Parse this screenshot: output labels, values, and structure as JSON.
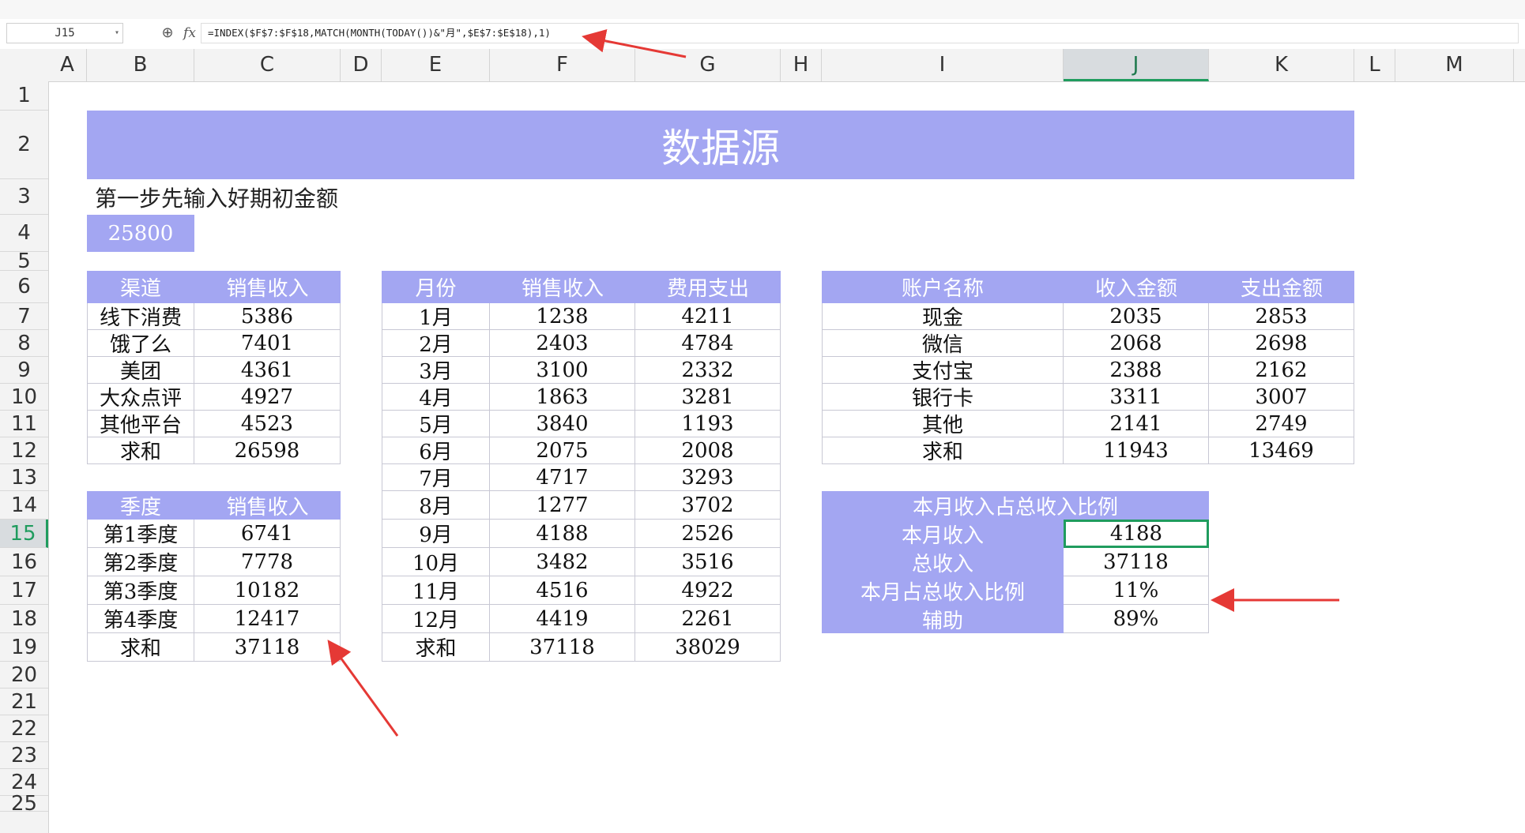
{
  "formula_bar": {
    "name_box": "J15",
    "formula": "=INDEX($F$7:$F$18,MATCH(MONTH(TODAY())&\"月\",$E$7:$E$18),1)"
  },
  "columns": [
    "A",
    "B",
    "C",
    "D",
    "E",
    "F",
    "G",
    "H",
    "I",
    "J",
    "K",
    "L",
    "M"
  ],
  "selected_column": "J",
  "rows": [
    "1",
    "2",
    "3",
    "4",
    "5",
    "6",
    "7",
    "8",
    "9",
    "10",
    "11",
    "12",
    "13",
    "14",
    "15",
    "16",
    "17",
    "18",
    "19",
    "20",
    "21",
    "22",
    "23",
    "24",
    "25"
  ],
  "selected_row": "15",
  "banner": "数据源",
  "step_text": "第一步先输入好期初金额",
  "initial_amount": "25800",
  "channel_table": {
    "headers": [
      "渠道",
      "销售收入"
    ],
    "rows": [
      [
        "线下消费",
        "5386"
      ],
      [
        "饿了么",
        "7401"
      ],
      [
        "美团",
        "4361"
      ],
      [
        "大众点评",
        "4927"
      ],
      [
        "其他平台",
        "4523"
      ],
      [
        "求和",
        "26598"
      ]
    ]
  },
  "quarter_table": {
    "headers": [
      "季度",
      "销售收入"
    ],
    "rows": [
      [
        "第1季度",
        "6741"
      ],
      [
        "第2季度",
        "7778"
      ],
      [
        "第3季度",
        "10182"
      ],
      [
        "第4季度",
        "12417"
      ],
      [
        "求和",
        "37118"
      ]
    ]
  },
  "month_table": {
    "headers": [
      "月份",
      "销售收入",
      "费用支出"
    ],
    "rows": [
      [
        "1月",
        "1238",
        "4211"
      ],
      [
        "2月",
        "2403",
        "4784"
      ],
      [
        "3月",
        "3100",
        "2332"
      ],
      [
        "4月",
        "1863",
        "3281"
      ],
      [
        "5月",
        "3840",
        "1193"
      ],
      [
        "6月",
        "2075",
        "2008"
      ],
      [
        "7月",
        "4717",
        "3293"
      ],
      [
        "8月",
        "1277",
        "3702"
      ],
      [
        "9月",
        "4188",
        "2526"
      ],
      [
        "10月",
        "3482",
        "3516"
      ],
      [
        "11月",
        "4516",
        "4922"
      ],
      [
        "12月",
        "4419",
        "2261"
      ],
      [
        "求和",
        "37118",
        "38029"
      ]
    ]
  },
  "account_table": {
    "headers": [
      "账户名称",
      "收入金额",
      "支出金额"
    ],
    "rows": [
      [
        "现金",
        "2035",
        "2853"
      ],
      [
        "微信",
        "2068",
        "2698"
      ],
      [
        "支付宝",
        "2388",
        "2162"
      ],
      [
        "银行卡",
        "3311",
        "3007"
      ],
      [
        "其他",
        "2141",
        "2749"
      ],
      [
        "求和",
        "11943",
        "13469"
      ]
    ]
  },
  "ratio_table": {
    "title": "本月收入占总收入比例",
    "rows": [
      [
        "本月收入",
        "4188"
      ],
      [
        "总收入",
        "37118"
      ],
      [
        "本月占总收入比例",
        "11%"
      ],
      [
        "辅助",
        "89%"
      ]
    ]
  },
  "colors": {
    "header_fill": "#a3a6f2",
    "selection": "#1f9c5e",
    "arrow": "#e53935"
  }
}
